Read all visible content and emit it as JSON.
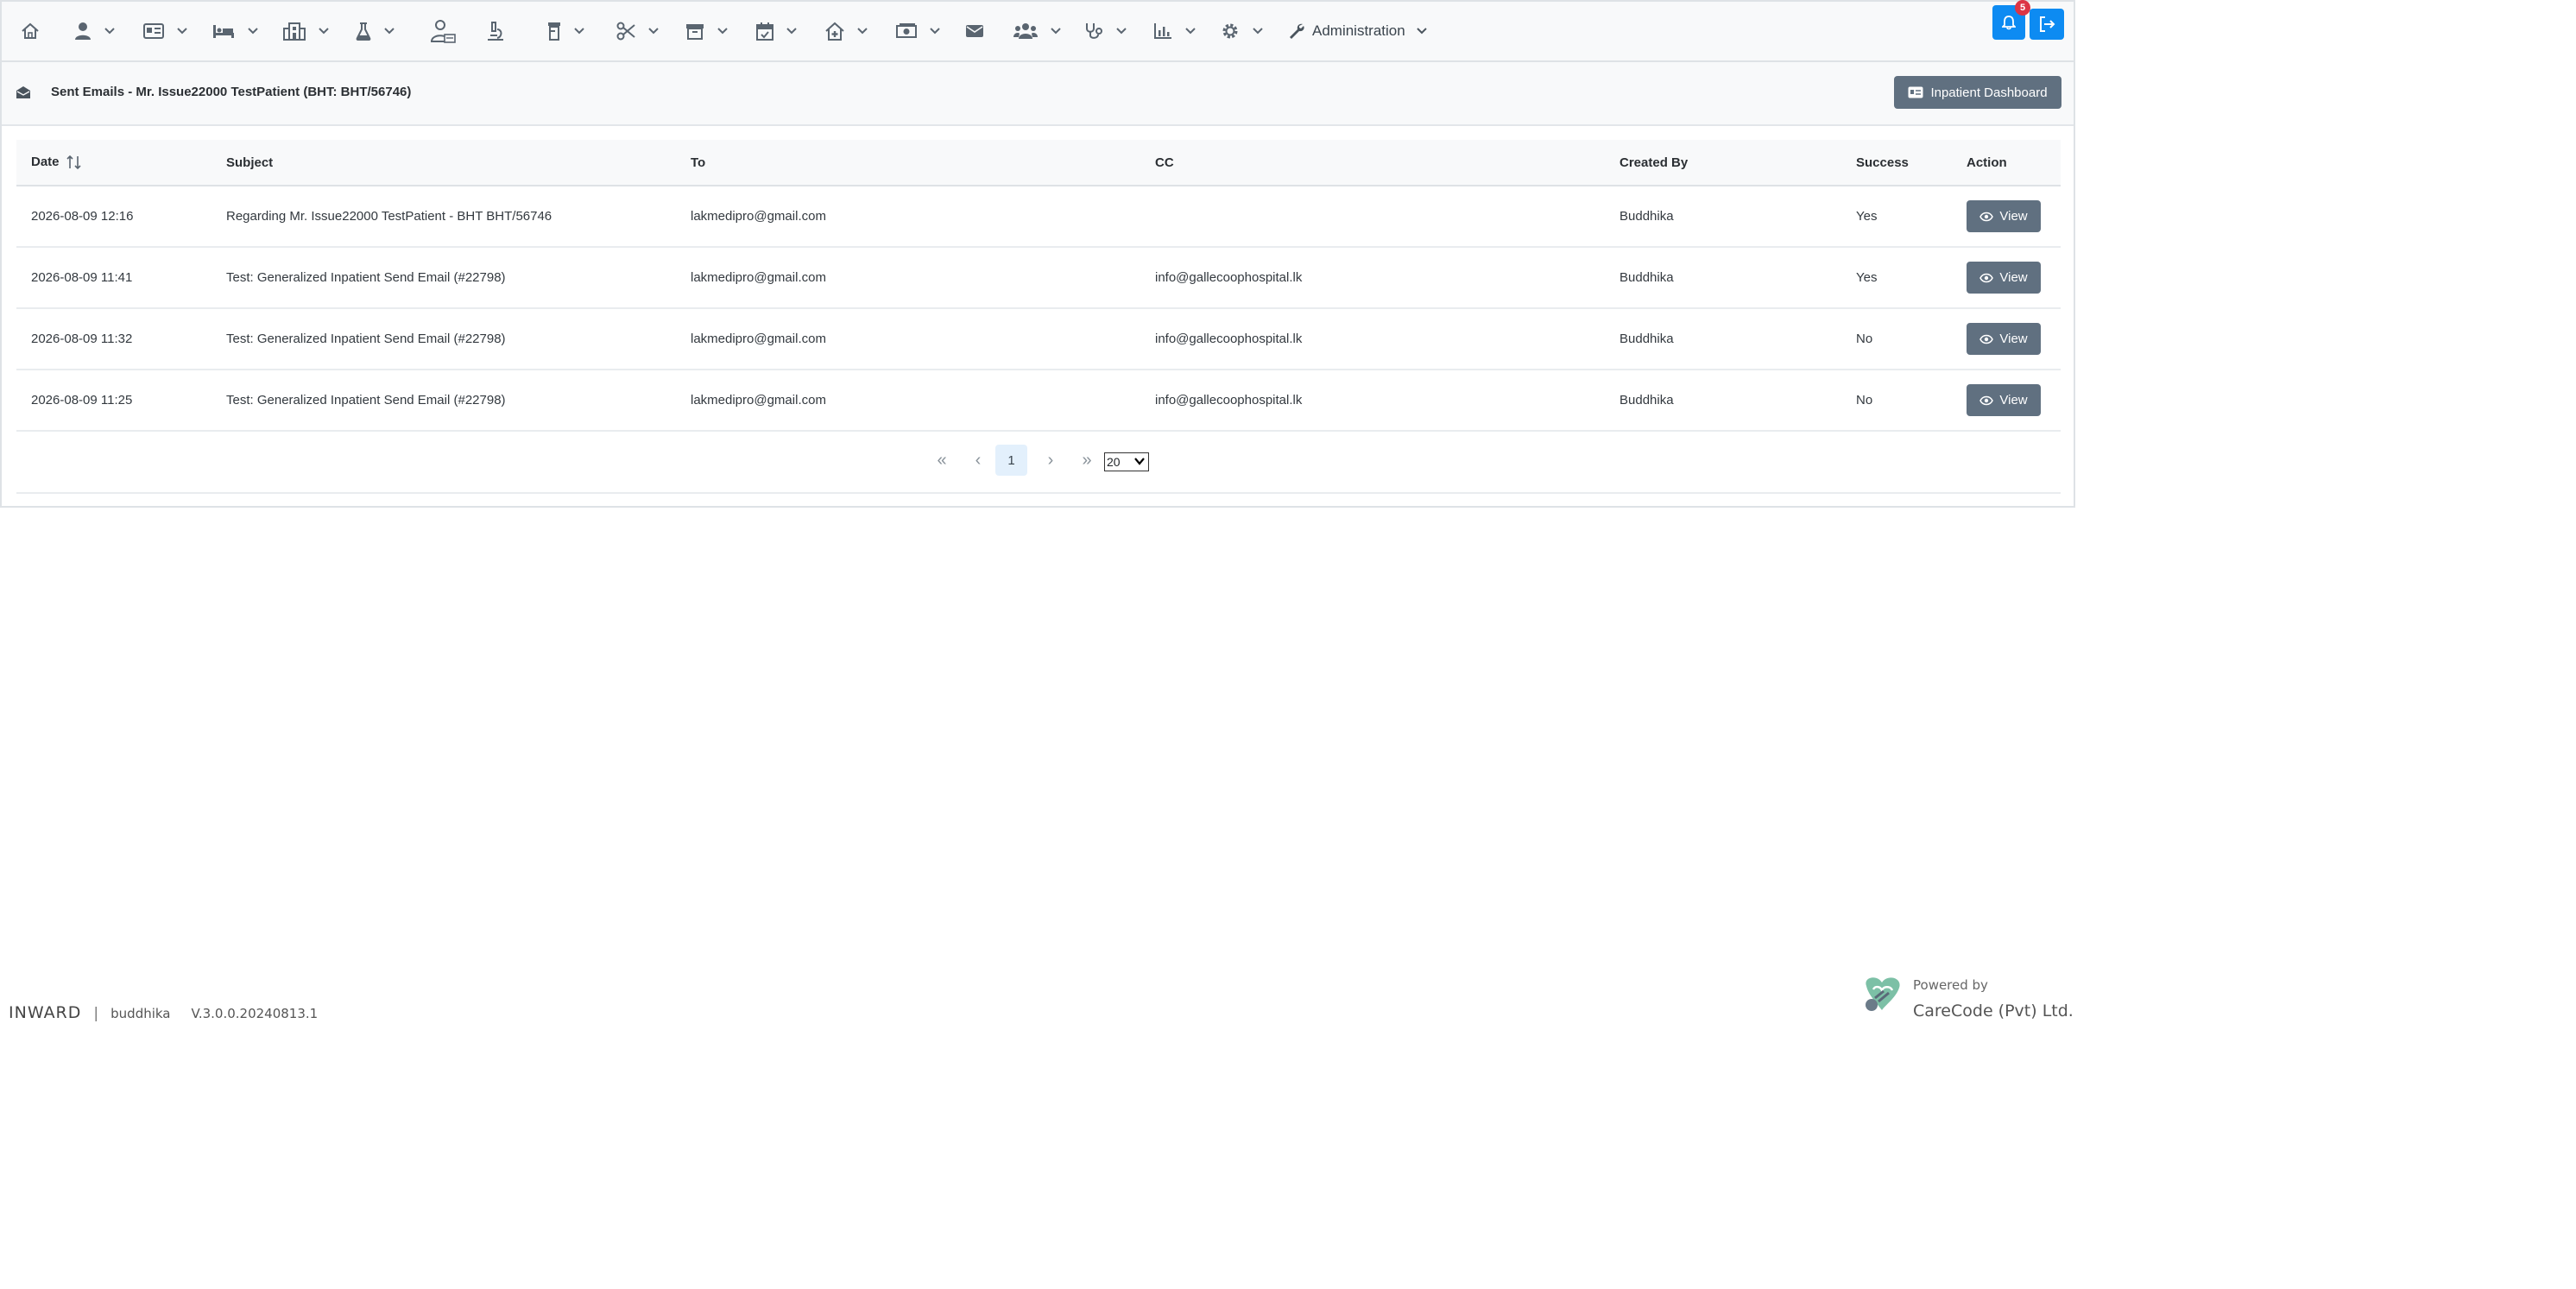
{
  "navbar": {
    "items": [
      {
        "icon": "home-icon"
      },
      {
        "icon": "user-icon",
        "dropdown": true
      },
      {
        "icon": "id-card-icon",
        "dropdown": true
      },
      {
        "icon": "bed-icon",
        "dropdown": true
      },
      {
        "icon": "building-icon",
        "dropdown": true
      },
      {
        "icon": "flask-icon",
        "dropdown": true
      },
      {
        "icon": "user-doctor-icon"
      },
      {
        "icon": "microscope-icon"
      },
      {
        "icon": "prescription-bottle-icon",
        "dropdown": true
      },
      {
        "icon": "scissors-icon",
        "dropdown": true
      },
      {
        "icon": "archive-icon",
        "dropdown": true
      },
      {
        "icon": "calendar-check-icon",
        "dropdown": true
      },
      {
        "icon": "house-medical-icon",
        "dropdown": true
      },
      {
        "icon": "money-bill-icon",
        "dropdown": true
      },
      {
        "icon": "envelope-icon"
      },
      {
        "icon": "users-icon",
        "dropdown": true
      },
      {
        "icon": "stethoscope-icon",
        "dropdown": true
      },
      {
        "icon": "bar-chart-icon",
        "dropdown": true
      },
      {
        "icon": "gear-icon",
        "dropdown": true
      }
    ],
    "admin_label": "Administration",
    "notification_count": "5"
  },
  "header": {
    "title": "Sent Emails - Mr. Issue22000 TestPatient (BHT: BHT/56746)",
    "dashboard_button": "Inpatient Dashboard"
  },
  "table": {
    "columns": {
      "date": "Date",
      "subject": "Subject",
      "to": "To",
      "cc": "CC",
      "created_by": "Created By",
      "success": "Success",
      "action": "Action"
    },
    "view_label": "View",
    "rows": [
      {
        "date": "2026-08-09 12:16",
        "subject": "Regarding Mr. Issue22000 TestPatient - BHT BHT/56746",
        "to": "lakmedipro@gmail.com",
        "cc": "",
        "created_by": "Buddhika",
        "success": "Yes"
      },
      {
        "date": "2026-08-09 11:41",
        "subject": "Test: Generalized Inpatient Send Email (#22798)",
        "to": "lakmedipro@gmail.com",
        "cc": "info@gallecoophospital.lk",
        "created_by": "Buddhika",
        "success": "Yes"
      },
      {
        "date": "2026-08-09 11:32",
        "subject": "Test: Generalized Inpatient Send Email (#22798)",
        "to": "lakmedipro@gmail.com",
        "cc": "info@gallecoophospital.lk",
        "created_by": "Buddhika",
        "success": "No"
      },
      {
        "date": "2026-08-09 11:25",
        "subject": "Test: Generalized Inpatient Send Email (#22798)",
        "to": "lakmedipro@gmail.com",
        "cc": "info@gallecoophospital.lk",
        "created_by": "Buddhika",
        "success": "No"
      }
    ]
  },
  "paginator": {
    "first": "«",
    "prev": "‹",
    "current_page": "1",
    "next": "›",
    "last": "»",
    "rows_per_page": "20"
  },
  "footer": {
    "app_name": "INWARD",
    "separator": "|",
    "user": "buddhika",
    "version": "V.3.0.0.20240813.1",
    "powered_by": "Powered by",
    "company": "CareCode (Pvt) Ltd."
  },
  "colors": {
    "primary": "#0d8bf2",
    "secondary_button": "#607080",
    "badge": "#dc3545"
  }
}
